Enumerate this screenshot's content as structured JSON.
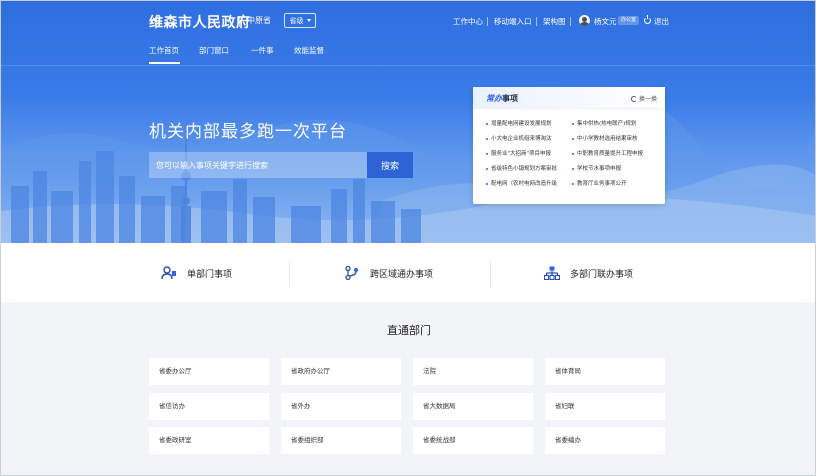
{
  "header": {
    "brand": "维森市人民政府",
    "province": "中原省",
    "switch_label": "省级",
    "links": [
      "工作中心",
      "移动端入口",
      "架构图"
    ],
    "user_name": "杨文元",
    "user_role": "办公室",
    "logout": "退出"
  },
  "nav": {
    "tabs": [
      "工作首页",
      "部门窗口",
      "一件事",
      "效能监督"
    ],
    "active": "工作首页"
  },
  "hero": {
    "headline": "机关内部最多跑一次平台",
    "search_placeholder": "您可以输入事项关键字进行搜索",
    "search_button": "搜索"
  },
  "hot": {
    "title_highlight": "常办",
    "title_rest": "事项",
    "refresh": "换一换",
    "items_left": [
      "增量配电网建设发展规划",
      "小大电企业机组来博淘汰",
      "服务业\"大招商\"项目申报",
      "省级特色小镇规划方案审批",
      "配电网（农村电网改造升级"
    ],
    "items_right": [
      "集中供热(热电联产)规划",
      "中小学教材选用结果审核",
      "中职教育质量提升工程申报",
      "学校节水事项申报",
      "教育厅业务事项公开"
    ]
  },
  "categories": [
    {
      "label": "单部门事项",
      "icon": "user-group-icon"
    },
    {
      "label": "跨区域通办事项",
      "icon": "branch-icon"
    },
    {
      "label": "多部门联办事项",
      "icon": "org-chart-icon"
    }
  ],
  "departments": {
    "title": "直通部门",
    "rows": [
      [
        "省委办公厅",
        "省政府办公厅",
        "法院",
        "省体育局"
      ],
      [
        "省信访办",
        "省外办",
        "省大数据局",
        "省妇联"
      ],
      [
        "省委政研室",
        "省委组织部",
        "省委统战部",
        "省委编办"
      ]
    ]
  },
  "colors": {
    "primary": "#2c64d6",
    "hero_top": "#2f6ee0",
    "accent_text": "#2b66e4"
  }
}
